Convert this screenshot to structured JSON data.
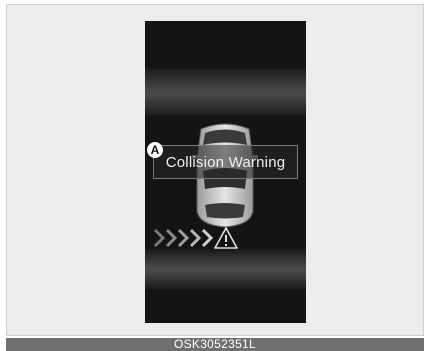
{
  "display": {
    "message": "Collision Warning",
    "callout_letter": "A",
    "icons": {
      "car": "car-top-view-icon",
      "approach": "chevron-arrows-icon",
      "alert": "warning-triangle-icon"
    },
    "colors": {
      "screen_bg": "#141414",
      "text": "#f2f2f2"
    }
  },
  "caption": {
    "code": "OSK3052351L"
  }
}
